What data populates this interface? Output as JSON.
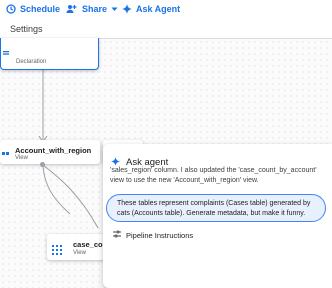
{
  "toolbar": {
    "schedule_label": "Schedule",
    "share_label": "Share",
    "ask_agent_label": "Ask Agent"
  },
  "settings": {
    "label": "Settings"
  },
  "nodes": {
    "declaration": {
      "subtitle": "Declaration"
    },
    "account_with_region": {
      "title": "Account_with_region",
      "subtitle": "View"
    },
    "case_count": {
      "title": "case_cou",
      "subtitle": "View"
    }
  },
  "agent_panel": {
    "title": "Ask agent",
    "message_line1": "'sales_region' column. I also updated the 'case_count_by_account'",
    "message_line2": "view to use the new 'Account_with_region' view.",
    "prompt_line1": "These tables represent complaints (Cases table) generated by",
    "prompt_line2": "cats (Accounts table). Generate metadata, but make it funny.",
    "pipeline_label": "Pipeline Instructions"
  },
  "colors": {
    "accent": "#1a73e8",
    "node_border": "#1a73e8",
    "prompt_border": "#4285f4",
    "prompt_bg": "#e8f0fe"
  }
}
